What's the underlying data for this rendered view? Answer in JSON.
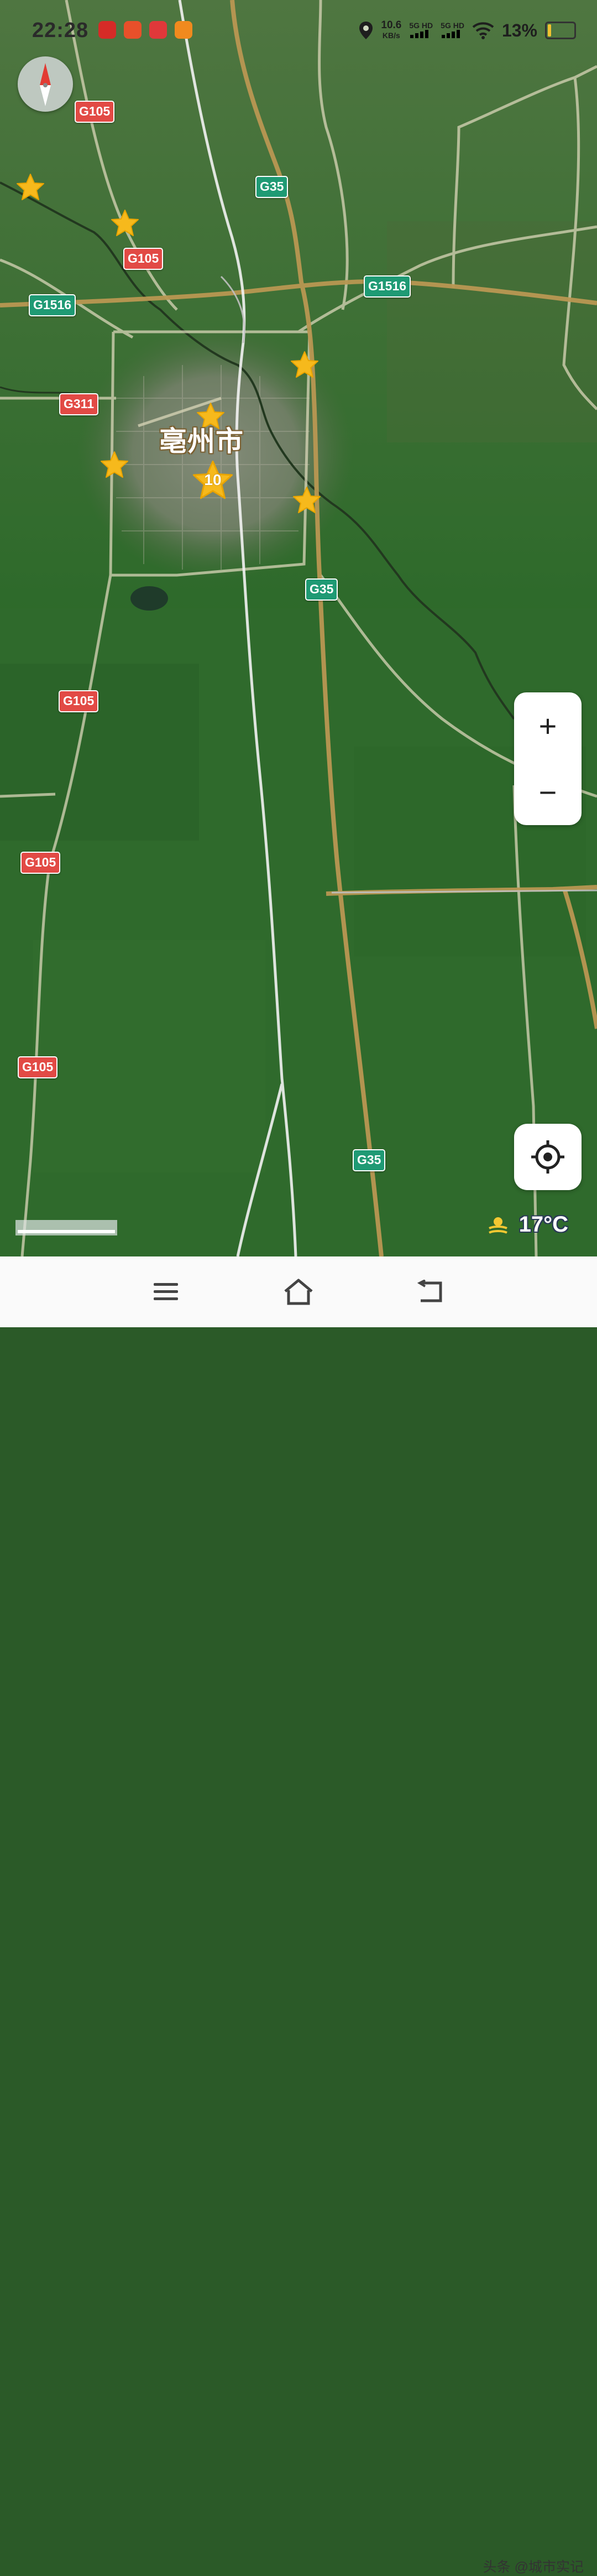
{
  "status_bar": {
    "time": "22:28",
    "net_speed_value": "10.6",
    "net_speed_unit": "KB/s",
    "signal_1": "5G HD",
    "signal_2": "5G HD",
    "battery_percent": "13%",
    "app_icons": [
      "app-icon-1",
      "taobao-icon",
      "app-icon-3",
      "app-icon-4"
    ]
  },
  "map": {
    "city_label": "亳州市",
    "cluster_count": "10",
    "road_shields": [
      {
        "label": "G105",
        "color": "red"
      },
      {
        "label": "G35",
        "color": "green"
      },
      {
        "label": "G105",
        "color": "red"
      },
      {
        "label": "G1516",
        "color": "green"
      },
      {
        "label": "G1516",
        "color": "green"
      },
      {
        "label": "G311",
        "color": "red"
      },
      {
        "label": "G35",
        "color": "green"
      },
      {
        "label": "G105",
        "color": "red"
      },
      {
        "label": "G105",
        "color": "red"
      },
      {
        "label": "G105",
        "color": "red"
      },
      {
        "label": "G35",
        "color": "green"
      }
    ],
    "colors": {
      "road_red": "#e24a45",
      "road_green": "#1f9a74",
      "star": "#f6b91c",
      "farmland": "#2f6a2c"
    }
  },
  "controls": {
    "zoom_in": "+",
    "zoom_out": "−"
  },
  "weather": {
    "icon": "sun-haze-icon",
    "temperature": "17°C"
  },
  "nav_bar": {
    "icons": [
      "menu-icon",
      "home-icon",
      "back-icon"
    ]
  },
  "watermark": "头条 @城市实记"
}
